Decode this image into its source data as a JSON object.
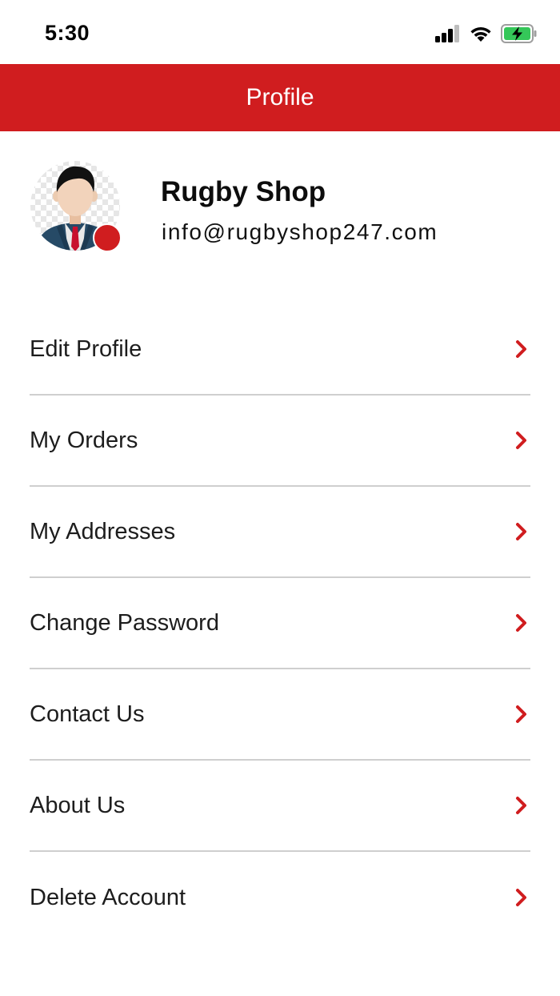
{
  "status_bar": {
    "time": "5:30",
    "icons": [
      "signal-icon",
      "wifi-icon",
      "battery-charging-icon"
    ]
  },
  "header": {
    "title": "Profile",
    "background_color": "#d01d1f"
  },
  "profile": {
    "name": "Rugby Shop",
    "email": "info@rugbyshop247.com"
  },
  "menu": {
    "items": [
      {
        "label": "Edit Profile"
      },
      {
        "label": "My Orders"
      },
      {
        "label": "My Addresses"
      },
      {
        "label": "Change Password"
      },
      {
        "label": "Contact Us"
      },
      {
        "label": "About Us"
      },
      {
        "label": "Delete Account"
      }
    ],
    "chevron_icon": "chevron-right-icon",
    "accent_color": "#d01d1f"
  }
}
